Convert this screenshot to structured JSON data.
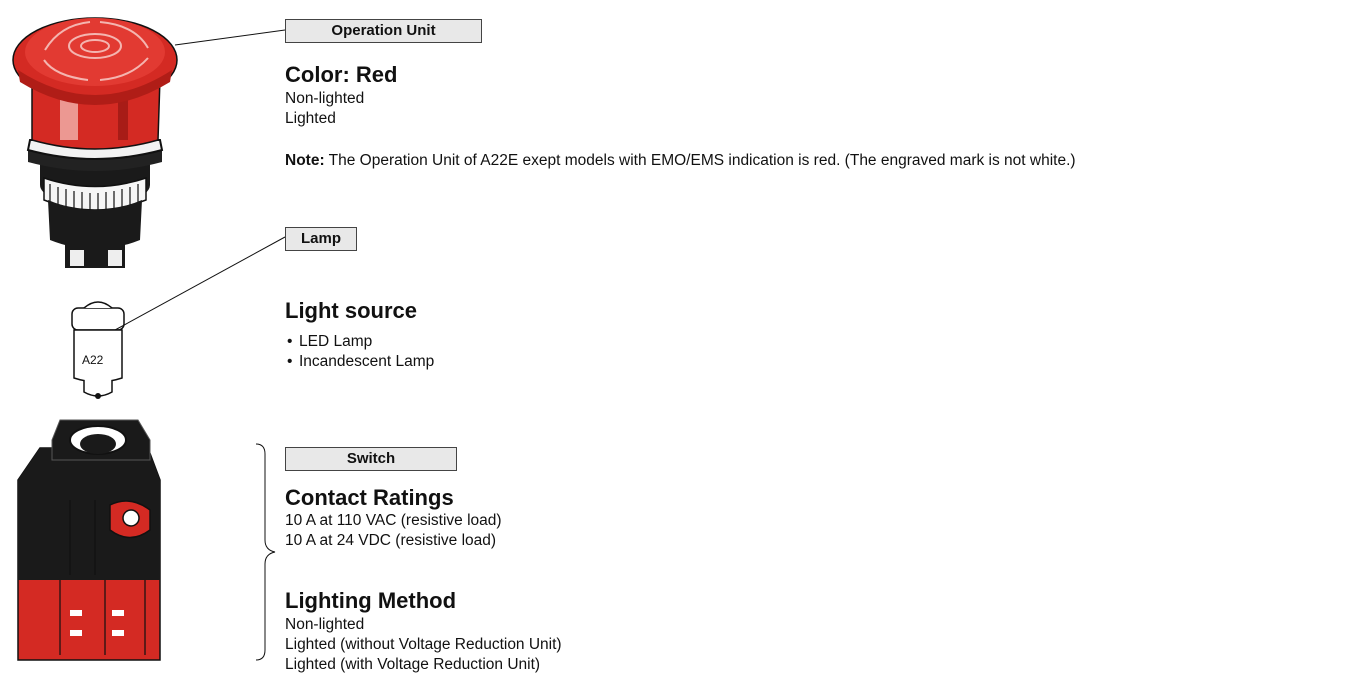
{
  "operation_unit": {
    "label": "Operation Unit",
    "heading": "Color: Red",
    "lines": [
      "Non-lighted",
      "Lighted"
    ],
    "note_prefix": "Note:",
    "note_text": " The Operation Unit of A22E exept models with EMO/EMS indication is red. (The engraved mark is not white.)"
  },
  "lamp": {
    "label": "Lamp",
    "heading": "Light source",
    "items": [
      "LED Lamp",
      "Incandescent Lamp"
    ],
    "engraving": "A22"
  },
  "switch": {
    "label": "Switch",
    "contact_heading": "Contact Ratings",
    "contact_lines": [
      "10 A at 110 VAC (resistive load)",
      "10 A at 24 VDC (resistive load)"
    ],
    "lighting_heading": "Lighting Method",
    "lighting_lines": [
      "Non-lighted",
      "Lighted (without Voltage Reduction Unit)",
      "Lighted (with Voltage Reduction Unit)"
    ]
  },
  "colors": {
    "product_red": "#d42a23",
    "label_bg": "#e8e8e8",
    "body_black": "#1a1a1a"
  }
}
